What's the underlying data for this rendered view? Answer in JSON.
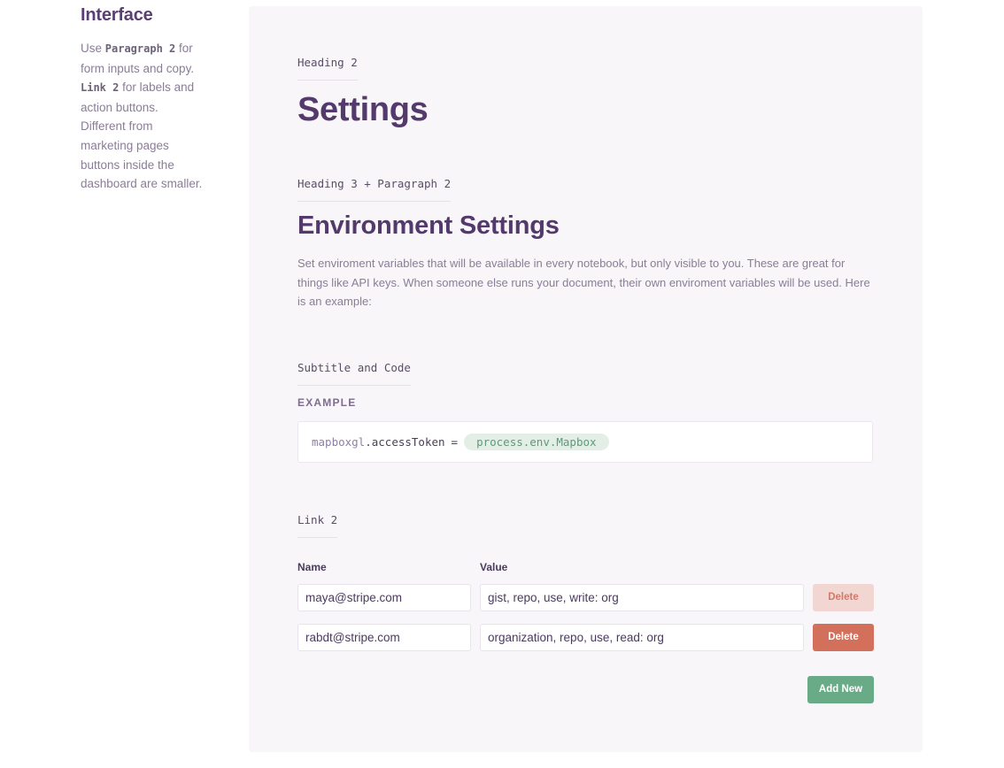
{
  "sidebar": {
    "title": "Interface",
    "text_1": "Use",
    "code_1": "Paragraph 2",
    "text_2": "for form inputs and copy.",
    "code_2": "Link 2",
    "text_3": "for labels and action buttons. Different from marketing pages buttons inside the dashboard are smaller."
  },
  "panel": {
    "label_heading2": "Heading 2",
    "heading2": "Settings",
    "label_heading3": "Heading 3 + Paragraph 2",
    "heading3": "Environment Settings",
    "paragraph": "Set enviroment variables that will be available in every notebook, but only visible to you. These are great for things like API keys. When someone else runs your document, their own enviroment variables will be used. Here is an example:",
    "label_subtitle": "Subtitle and Code",
    "subtitle": "EXAMPLE",
    "code": {
      "object": "mapboxgl",
      "property": ".accessToken",
      "operator": "=",
      "value": "process.env.Mapbox"
    },
    "label_link2": "Link 2",
    "table": {
      "name_header": "Name",
      "value_header": "Value",
      "rows": [
        {
          "name": "maya@stripe.com",
          "value": "gist, repo, use, write: org",
          "delete_label": "Delete"
        },
        {
          "name": "rabdt@stripe.com",
          "value": "organization, repo, use, read: org",
          "delete_label": "Delete"
        }
      ]
    },
    "add_label": "Add New"
  },
  "colors": {
    "heading": "#543a6c",
    "panel_bg": "#f8f6f9",
    "delete": "#d3705c",
    "delete_light": "#f1d6d2",
    "add": "#6aab87",
    "code_env_bg": "#e3efe6"
  }
}
